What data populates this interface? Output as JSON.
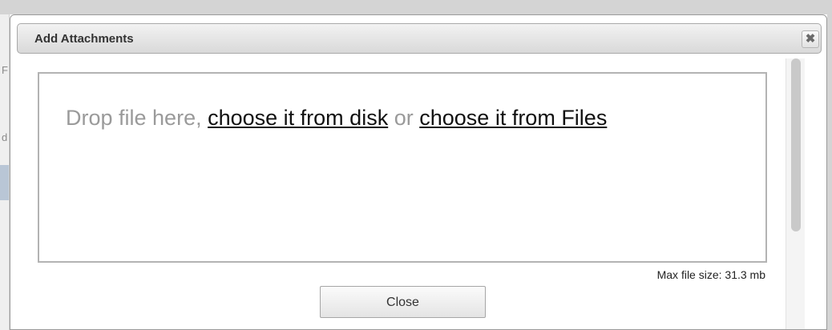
{
  "background": {
    "fragments": [
      "F",
      "d"
    ]
  },
  "dialog": {
    "title": "Add Attachments",
    "close_icon": "✖",
    "dropzone": {
      "prefix": "Drop file here,",
      "link_disk": "choose it from disk",
      "separator": "or",
      "link_files": "choose it from Files"
    },
    "max_file_size": "Max file size: 31.3 mb",
    "close_button_label": "Close"
  }
}
